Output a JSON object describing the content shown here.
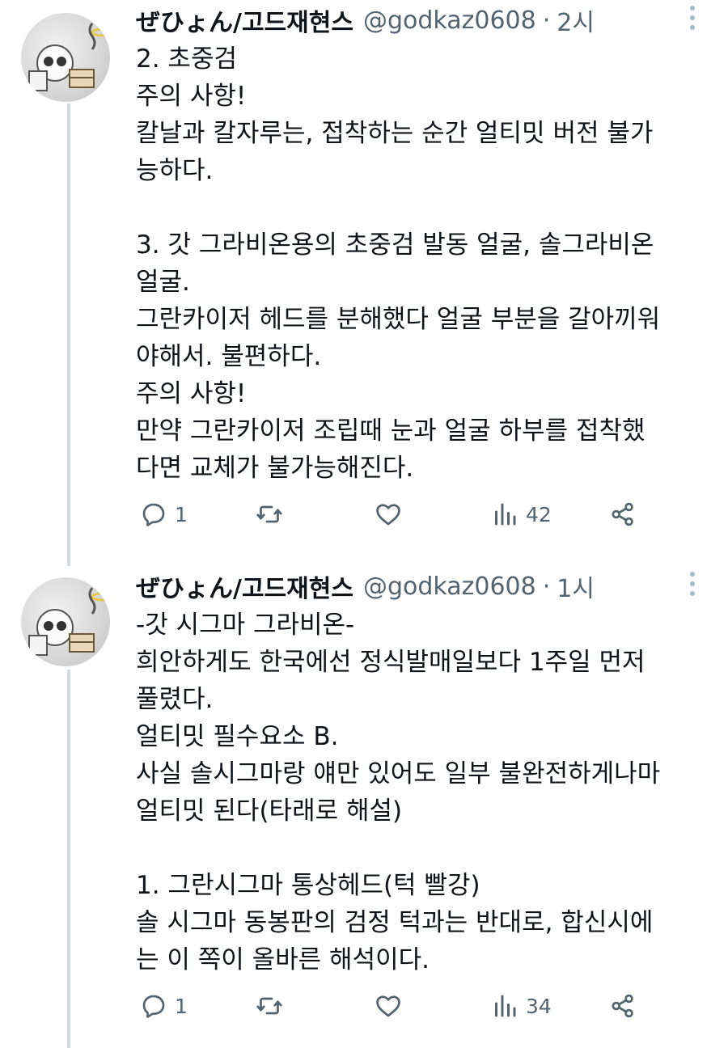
{
  "tweets": [
    {
      "display_name": "ぜひょん/고드재현스",
      "handle": "@godkaz0608",
      "separator": "·",
      "time": "2시",
      "lines": [
        "2. 초중검",
        "주의 사항!",
        "칼날과 칼자루는, 접착하는 순간 얼티밋 버전 불가",
        "능하다.",
        "",
        "3. 갓 그라비온용의 초중검 발동 얼굴, 솔그라비온",
        "얼굴.",
        "그란카이저 헤드를 분해했다 얼굴 부분을 갈아끼워",
        "야해서. 불편하다.",
        "주의 사항!",
        "만약 그란카이저 조립때 눈과 얼굴 하부를 접착했",
        "다면 교체가 불가능해진다."
      ],
      "reply_count": "1",
      "retweet_count": "",
      "like_count": "",
      "view_count": "42"
    },
    {
      "display_name": "ぜひょん/고드재현스",
      "handle": "@godkaz0608",
      "separator": "·",
      "time": "1시",
      "lines": [
        "-갓 시그마 그라비온-",
        "희안하게도 한국에선 정식발매일보다 1주일 먼저",
        "풀렸다.",
        "얼티밋 필수요소 B.",
        "사실 솔시그마랑 얘만 있어도 일부 불완전하게나마",
        "얼티밋 된다(타래로 해설)",
        "",
        "1. 그란시그마 통상헤드(턱 빨강)",
        "솔 시그마 동봉판의 검정 턱과는 반대로, 합신시에",
        "는 이 쪽이 올바른 해석이다."
      ],
      "reply_count": "1",
      "retweet_count": "",
      "like_count": "",
      "view_count": "34"
    }
  ],
  "icons": {
    "reply": "reply-icon",
    "retweet": "retweet-icon",
    "like": "like-icon",
    "views": "views-icon",
    "share": "share-icon",
    "more": "more-icon"
  },
  "colors": {
    "text": "#0f1419",
    "secondary": "#536471",
    "thread_line": "#cfd9de"
  }
}
